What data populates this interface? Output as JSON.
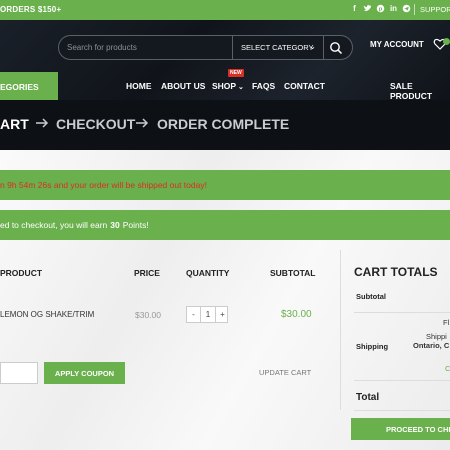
{
  "topbar": {
    "promo": "ORDERS $150+",
    "socials": [
      "f",
      "t",
      "p",
      "in",
      "tg"
    ],
    "support": "SUPPORT"
  },
  "header": {
    "search_placeholder": "Search for products",
    "category_label": "SELECT CATEGORY",
    "my_account": "MY ACCOUNT",
    "categories_btn": "EGORIES",
    "nav": [
      "HOME",
      "ABOUT US",
      "SHOP",
      "FAQS",
      "CONTACT"
    ],
    "new_badge": "NEW",
    "sale": "SALE PRODUCT"
  },
  "steps": {
    "cart": "ART",
    "checkout": "CHECKOUT",
    "complete": "ORDER COMPLETE"
  },
  "notices": {
    "shipping": "n 9h 54m 26s and your order will be shipped out today!",
    "points_before": "ed to checkout, you will earn",
    "points_value": "30",
    "points_after": "Points!"
  },
  "table": {
    "headers": [
      "PRODUCT",
      "PRICE",
      "QUANTITY",
      "SUBTOTAL"
    ],
    "row": {
      "name": "LEMON OG SHAKE/TRIM",
      "price": "$30.00",
      "qty": "1",
      "subtotal": "$30.00"
    }
  },
  "actions": {
    "apply_coupon": "APPLY COUPON",
    "update_cart": "UPDATE CART"
  },
  "totals": {
    "title": "CART TOTALS",
    "subtotal_label": "Subtotal",
    "shipping_label": "Shipping",
    "shipping_line1": "Fl",
    "shipping_line2": "Shippi",
    "shipping_line3": "Ontario, C",
    "change": "C",
    "total_label": "Total",
    "proceed": "PROCEED TO CHECKOUT"
  },
  "colors": {
    "accent": "#6ab04c",
    "dark": "#151a22",
    "alert": "#d93025"
  }
}
